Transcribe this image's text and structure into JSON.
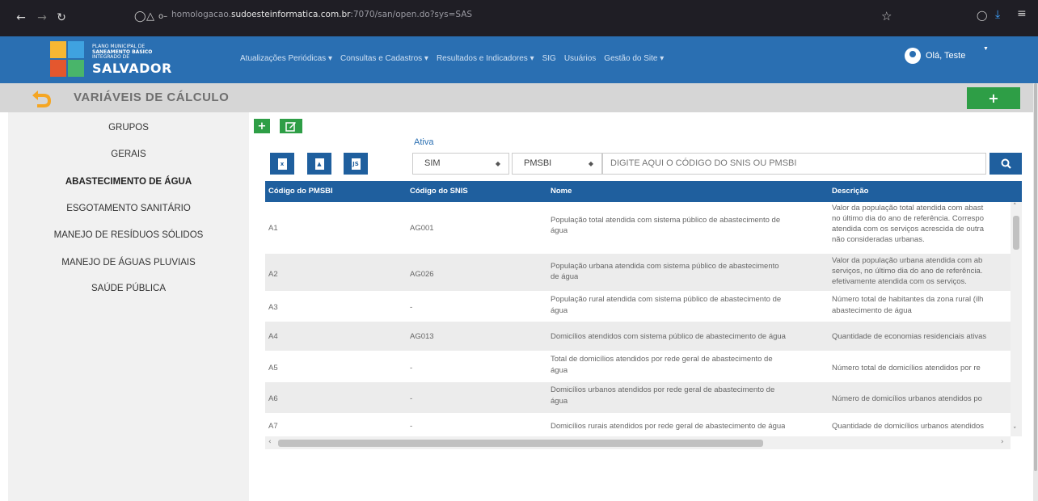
{
  "browser": {
    "url_prefix": "homologacao.",
    "url_host": "sudoesteinformatica.com.br",
    "url_suffix": ":7070/san/open.do?sys=SAS"
  },
  "logo": {
    "small_line1": "PLANO MUNICIPAL DE",
    "small_line2": "SANEAMENTO BÁSICO",
    "small_line3": "INTEGRADO DE",
    "big": "SALVADOR"
  },
  "menu": {
    "items": [
      {
        "label": "Atualizações Periódicas ▾"
      },
      {
        "label": "Consultas e Cadastros ▾"
      },
      {
        "label": "Resultados e Indicadores ▾"
      },
      {
        "label": "SIG"
      },
      {
        "label": "Usuários"
      },
      {
        "label": "Gestão do Site ▾"
      }
    ]
  },
  "user": {
    "greeting": "Olá, Teste"
  },
  "page": {
    "title": "VARIÁVEIS DE CÁLCULO",
    "add_label": "+"
  },
  "sidebar": {
    "items": [
      {
        "label": "GRUPOS"
      },
      {
        "label": "GERAIS"
      },
      {
        "label": "ABASTECIMENTO DE ÁGUA"
      },
      {
        "label": "ESGOTAMENTO SANITÁRIO"
      },
      {
        "label": "MANEJO DE RESÍDUOS SÓLIDOS"
      },
      {
        "label": "MANEJO DE ÁGUAS PLUVIAIS"
      },
      {
        "label": "SAÚDE PÚBLICA"
      }
    ]
  },
  "filters": {
    "ativa_label": "Ativa",
    "ativa_value": "SIM",
    "source_value": "PMSBI",
    "search_placeholder": "DIGITE AQUI O CÓDIGO DO SNIS OU PMSBI"
  },
  "table": {
    "headers": {
      "pmsbi": "Código do PMSBI",
      "snis": "Código do SNIS",
      "nome": "Nome",
      "descricao": "Descrição"
    },
    "rows": [
      {
        "pmsbi": "A1",
        "snis": "AG001",
        "nome1": "População total atendida com sistema público de abastecimento de",
        "nome2": "água",
        "d1": "Valor da população total atendida com abast",
        "d2": "no último dia do ano de referência. Correspo",
        "d3": "atendida com os serviços acrescida de outra",
        "d4": "não consideradas urbanas."
      },
      {
        "pmsbi": "A2",
        "snis": "AG026",
        "nome1": "População urbana atendida com sistema público de abastecimento",
        "nome2": "de água",
        "d1": "Valor da população urbana atendida com ab",
        "d2": "serviços, no último dia do ano de referência.",
        "d3": "efetivamente atendida com os serviços.",
        "d4": ""
      },
      {
        "pmsbi": "A3",
        "snis": "-",
        "nome1": "População rural atendida com sistema público de abastecimento de",
        "nome2": "água",
        "d1": "Número total de habitantes da zona rural (ilh",
        "d2": "abastecimento de água",
        "d3": "",
        "d4": ""
      },
      {
        "pmsbi": "A4",
        "snis": "AG013",
        "nome1": "Domicílios atendidos com sistema público de abastecimento de água",
        "nome2": "",
        "d1": "Quantidade de economias residenciais ativas",
        "d2": "",
        "d3": "",
        "d4": ""
      },
      {
        "pmsbi": "A5",
        "snis": "-",
        "nome1": "Total de domicílios atendidos por rede geral de abastecimento de",
        "nome2": "água",
        "d1": "Número total de domicílios atendidos por re",
        "d2": "",
        "d3": "",
        "d4": ""
      },
      {
        "pmsbi": "A6",
        "snis": "-",
        "nome1": "Domicílios urbanos atendidos por rede geral de abastecimento de",
        "nome2": "água",
        "d1": "Número de domicílios urbanos atendidos po",
        "d2": "",
        "d3": "",
        "d4": ""
      },
      {
        "pmsbi": "A7",
        "snis": "-",
        "nome1": "Domicílios rurais atendidos por rede geral de abastecimento de água",
        "nome2": "",
        "d1": "Quantidade de domicílios urbanos atendidos",
        "d2": "",
        "d3": "",
        "d4": ""
      }
    ]
  },
  "colors": {
    "header_blue": "#2a6fb2",
    "table_blue": "#1f5f9e",
    "accent_green": "#2e9e46",
    "back_orange": "#f5a623"
  }
}
